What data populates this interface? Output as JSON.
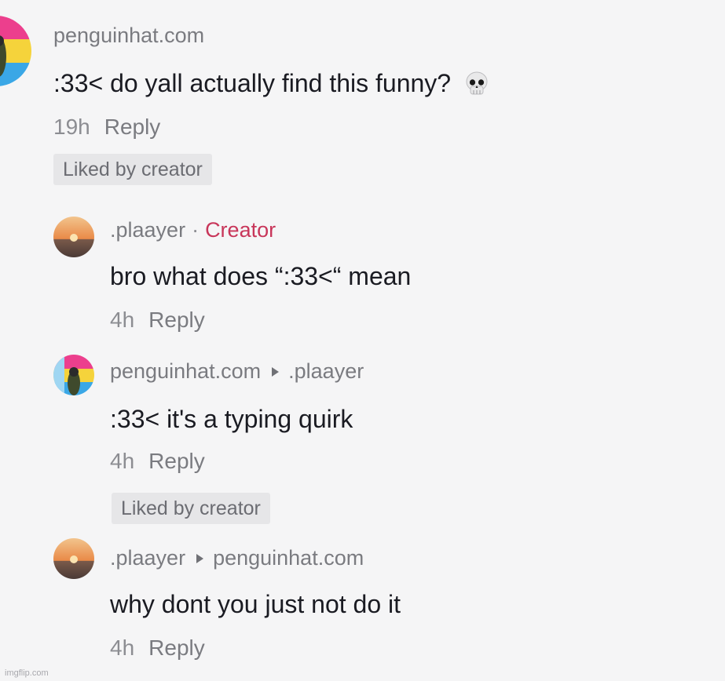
{
  "comments": [
    {
      "user": "penguinhat.com",
      "text": ":33< do yall actually find this funny?",
      "time": "19h",
      "reply": "Reply",
      "badge": "Liked by creator",
      "emoji_icon": "skull-icon"
    },
    {
      "user": ".plaayer",
      "separator": "·",
      "role": "Creator",
      "text": "bro what does “:33<“ mean",
      "time": "4h",
      "reply": "Reply"
    },
    {
      "user": "penguinhat.com",
      "reply_to": ".plaayer",
      "text": ":33< it's a typing quirk",
      "time": "4h",
      "reply": "Reply",
      "badge": "Liked by creator"
    },
    {
      "user": ".plaayer",
      "reply_to": "penguinhat.com",
      "text": "why dont you just not do it",
      "time": "4h",
      "reply": "Reply"
    }
  ],
  "colors": {
    "creator": "#c8365a",
    "muted": "#7a7b80",
    "badge_bg": "#e6e6e8",
    "background": "#f5f5f6"
  },
  "watermark": "imgflip.com"
}
